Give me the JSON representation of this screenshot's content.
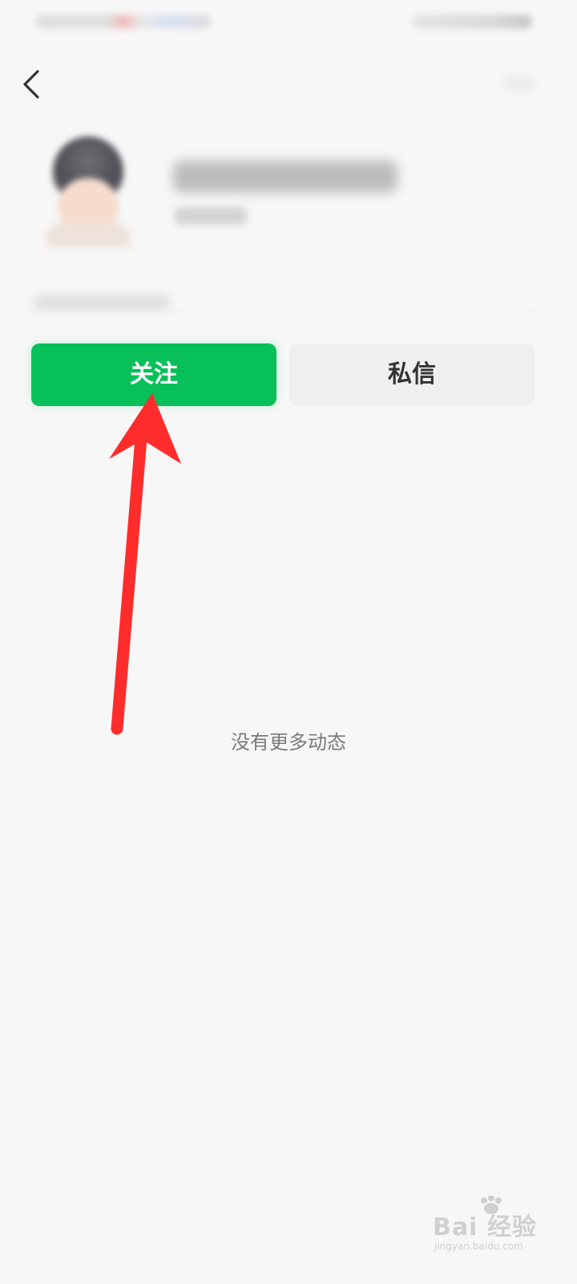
{
  "profile": {
    "follow_button_label": "关注",
    "message_button_label": "私信"
  },
  "feed": {
    "empty_text": "没有更多动态"
  },
  "watermark": {
    "main_text": "Bai 经验",
    "sub_text": "jingyan.baidu.com"
  },
  "colors": {
    "accent_green": "#08C05A",
    "secondary_button": "#EFEFEF",
    "annotation_arrow": "#FF2C2C"
  },
  "icons": {
    "back": "chevron-left-icon",
    "annotation": "arrow-up-annotation-icon"
  }
}
